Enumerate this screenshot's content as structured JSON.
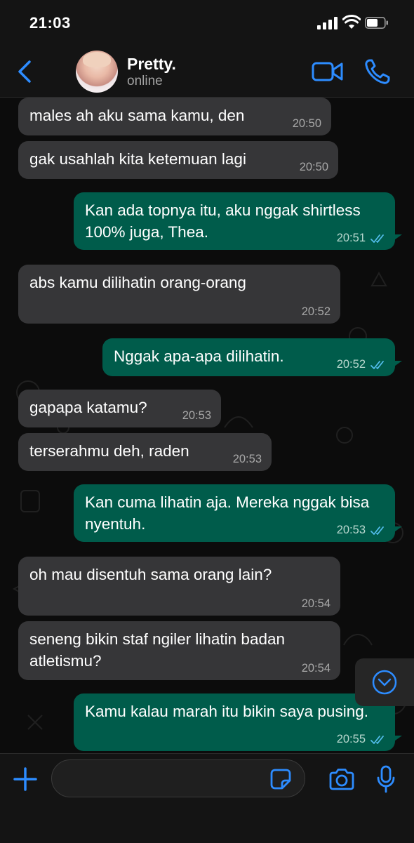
{
  "status_bar": {
    "time": "21:03"
  },
  "header": {
    "contact_name": "Pretty.",
    "contact_status": "online"
  },
  "messages": [
    {
      "direction": "in",
      "text": "males ah aku sama kamu, den",
      "time": "20:50"
    },
    {
      "direction": "in",
      "text": "gak usahlah kita ketemuan lagi",
      "time": "20:50"
    },
    {
      "direction": "out",
      "text": "Kan ada topnya itu, aku nggak shirtless 100% juga, Thea.",
      "time": "20:51",
      "read": true
    },
    {
      "direction": "in",
      "text": "abs kamu dilihatin orang-orang",
      "time": "20:52"
    },
    {
      "direction": "out",
      "text": "Nggak apa-apa dilihatin.",
      "time": "20:52",
      "read": true
    },
    {
      "direction": "in",
      "text": "gapapa katamu?",
      "time": "20:53"
    },
    {
      "direction": "in",
      "text": "terserahmu deh, raden",
      "time": "20:53"
    },
    {
      "direction": "out",
      "text": "Kan cuma lihatin aja. Mereka nggak bisa nyentuh.",
      "time": "20:53",
      "read": true
    },
    {
      "direction": "in",
      "text": "oh mau disentuh sama orang lain?",
      "time": "20:54"
    },
    {
      "direction": "in",
      "text": "seneng bikin staf ngiler lihatin badan atletismu?",
      "time": "20:54"
    },
    {
      "direction": "out",
      "text": "Kamu kalau marah itu bikin saya pusing.",
      "time": "20:55",
      "read": true
    }
  ],
  "input": {
    "value": "",
    "placeholder": ""
  },
  "icons": {
    "back": "chevron-left-icon",
    "video": "video-camera-icon",
    "call": "phone-icon",
    "plus": "plus-icon",
    "sticker": "sticker-icon",
    "camera": "camera-icon",
    "mic": "microphone-icon",
    "scroll": "chevron-down-circle-icon",
    "read": "double-check-icon"
  },
  "colors": {
    "accent": "#2d8cff",
    "outgoing_bubble": "#005c4b",
    "incoming_bubble": "#363638",
    "read_ticks": "#53bdeb"
  }
}
